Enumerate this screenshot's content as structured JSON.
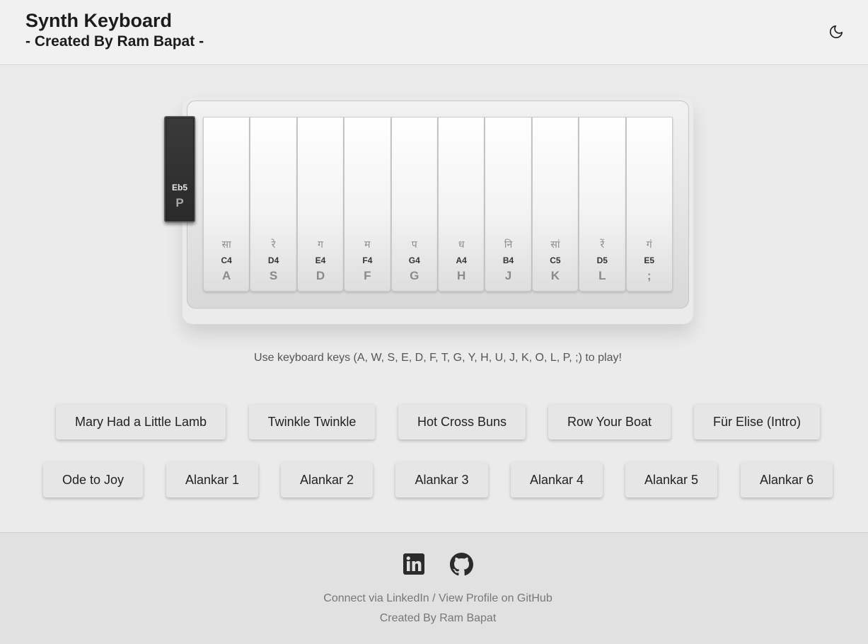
{
  "header": {
    "title": "Synth Keyboard",
    "subtitle": "- Created By Ram Bapat -",
    "theme_icon": "moon-icon"
  },
  "keyboard": {
    "white_keys": [
      {
        "swar": "सा",
        "note": "C4",
        "key": "A"
      },
      {
        "swar": "रे",
        "note": "D4",
        "key": "S"
      },
      {
        "swar": "ग",
        "note": "E4",
        "key": "D"
      },
      {
        "swar": "म",
        "note": "F4",
        "key": "F"
      },
      {
        "swar": "प",
        "note": "G4",
        "key": "G"
      },
      {
        "swar": "ध",
        "note": "A4",
        "key": "H"
      },
      {
        "swar": "नि",
        "note": "B4",
        "key": "J"
      },
      {
        "swar": "सां",
        "note": "C5",
        "key": "K"
      },
      {
        "swar": "रें",
        "note": "D5",
        "key": "L"
      },
      {
        "swar": "गं",
        "note": "E5",
        "key": ";"
      }
    ],
    "black_key": {
      "note": "Eb5",
      "key": "P"
    }
  },
  "instructions": "Use keyboard keys (A, W, S, E, D, F, T, G, Y, H, U, J, K, O, L, P, ;) to play!",
  "songs": {
    "row1": [
      "Mary Had a Little Lamb",
      "Twinkle Twinkle",
      "Hot Cross Buns",
      "Row Your Boat",
      "Für Elise (Intro)"
    ],
    "row2": [
      "Ode to Joy",
      "Alankar 1",
      "Alankar 2",
      "Alankar 3",
      "Alankar 4",
      "Alankar 5",
      "Alankar 6"
    ]
  },
  "footer": {
    "icons": [
      "linkedin-icon",
      "github-icon"
    ],
    "linkedin_label": "Connect via LinkedIn",
    "separator": " / ",
    "github_label": "View Profile on GitHub",
    "credit": "Created By Ram Bapat"
  }
}
